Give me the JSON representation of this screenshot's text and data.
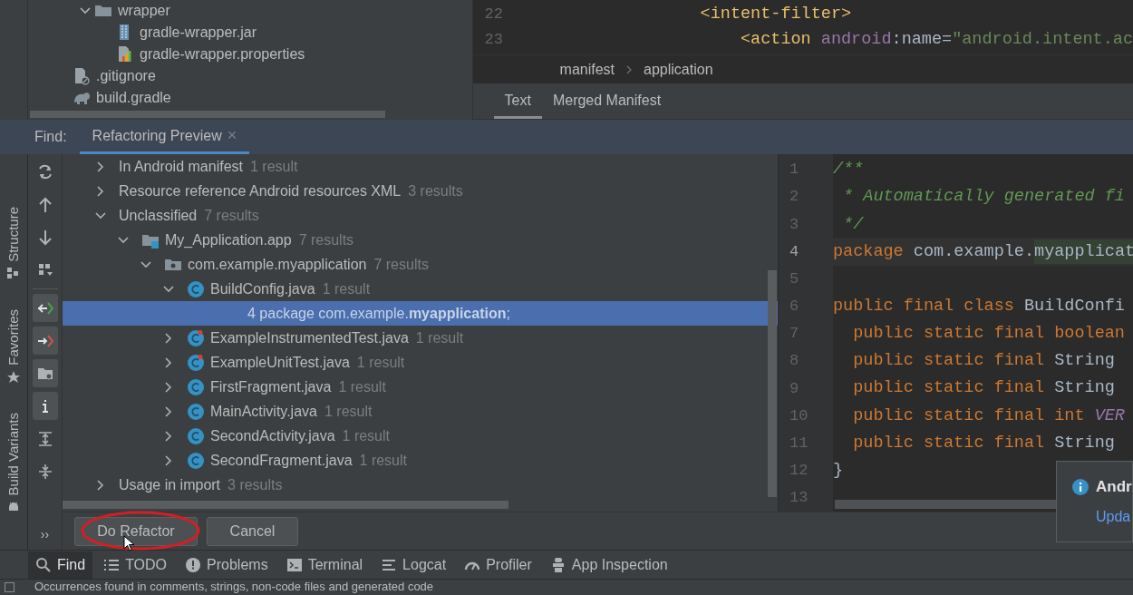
{
  "project_tree": {
    "items": [
      {
        "children": [
          {
            "label": "wrapper",
            "kind": "folder",
            "expanded": true,
            "children": [
              {
                "label": "gradle-wrapper.jar",
                "kind": "jar"
              },
              {
                "label": "gradle-wrapper.properties",
                "kind": "properties"
              }
            ]
          }
        ]
      },
      {
        "label": ".gitignore",
        "kind": "ignore"
      },
      {
        "label": "build.gradle",
        "kind": "gradle"
      }
    ]
  },
  "manifest_editor": {
    "lines": [
      {
        "number": "22",
        "tokens": [
          {
            "kind": "tag",
            "text": "          <intent-filter>"
          }
        ]
      },
      {
        "number": "23",
        "tokens": [
          {
            "kind": "tag",
            "text": "              <action "
          },
          {
            "kind": "attr",
            "text": "android"
          },
          {
            "kind": "plain",
            "text": ":name="
          },
          {
            "kind": "string",
            "text": "\"android.intent.ac"
          }
        ]
      }
    ],
    "breadcrumb": [
      "manifest",
      "application"
    ],
    "tabs": [
      {
        "label": "Text",
        "selected": true
      },
      {
        "label": "Merged Manifest",
        "selected": false
      }
    ]
  },
  "find_panel": {
    "label": "Find:",
    "tab": {
      "label": "Refactoring Preview",
      "close": "×"
    },
    "toolbar": [
      {
        "on": false
      },
      {
        "on": false
      },
      {
        "on": false
      },
      {
        "on": false
      },
      {
        "on": true
      },
      {
        "on": true
      },
      {
        "on": true
      },
      {
        "on": true
      },
      {
        "on": false
      },
      {
        "on": false
      }
    ],
    "more": "››",
    "side_tabs": [
      "Structure",
      "Favorites",
      "Build Variants"
    ],
    "tree": [
      {
        "label": "In Android manifest",
        "count": "1 result",
        "expanded": false,
        "selected": false
      },
      {
        "label": "Resource reference Android resources XML",
        "count": "3 results",
        "expanded": false,
        "selected": false
      },
      {
        "label": "Unclassified",
        "count": "7 results",
        "expanded": true,
        "selected": false,
        "children": [
          {
            "label": "My_Application.app",
            "count": "7 results",
            "kind": "module",
            "expanded": true,
            "selected": false,
            "children": [
              {
                "label": "com.example.myapplication",
                "count": "7 results",
                "kind": "package",
                "expanded": true,
                "selected": false,
                "children": [
                  {
                    "label": "BuildConfig.java",
                    "count": "1 result",
                    "kind": "class",
                    "expanded": true,
                    "selected": false,
                    "children": [
                      {
                        "label": "4 package com.example.**myapplication**;",
                        "kind": "match",
                        "selected": true
                      }
                    ]
                  },
                  {
                    "label": "ExampleInstrumentedTest.java",
                    "count": "1 result",
                    "kind": "test",
                    "expanded": false,
                    "selected": false
                  },
                  {
                    "label": "ExampleUnitTest.java",
                    "count": "1 result",
                    "kind": "test",
                    "expanded": false,
                    "selected": false
                  },
                  {
                    "label": "FirstFragment.java",
                    "count": "1 result",
                    "kind": "class",
                    "expanded": false,
                    "selected": false
                  },
                  {
                    "label": "MainActivity.java",
                    "count": "1 result",
                    "kind": "class",
                    "expanded": false,
                    "selected": false
                  },
                  {
                    "label": "SecondActivity.java",
                    "count": "1 result",
                    "kind": "class",
                    "expanded": false,
                    "selected": false
                  },
                  {
                    "label": "SecondFragment.java",
                    "count": "1 result",
                    "kind": "class",
                    "expanded": false,
                    "selected": false
                  }
                ]
              }
            ]
          }
        ]
      },
      {
        "label": "Usage in import",
        "count": "3 results",
        "expanded": false,
        "selected": false
      }
    ],
    "buttons": [
      {
        "label": "Do Refactor"
      },
      {
        "label": "Cancel"
      }
    ]
  },
  "preview_editor": {
    "lines": [
      {
        "number": "1",
        "tokens": [
          {
            "kind": "comment",
            "text": "/**"
          }
        ]
      },
      {
        "number": "2",
        "tokens": [
          {
            "kind": "comment",
            "text": " * Automatically generated fi"
          }
        ]
      },
      {
        "number": "3",
        "tokens": [
          {
            "kind": "comment",
            "text": " */"
          }
        ]
      },
      {
        "number": "4",
        "current": true,
        "tokens": [
          {
            "kind": "keyword",
            "text": "package "
          },
          {
            "kind": "plain",
            "text": "com.example."
          },
          {
            "kind": "highlight",
            "text": "myapplicat"
          }
        ]
      },
      {
        "number": "5"
      },
      {
        "number": "6",
        "tokens": [
          {
            "kind": "keyword",
            "text": "public final class "
          },
          {
            "kind": "plain",
            "text": "BuildConfi"
          }
        ]
      },
      {
        "number": "7",
        "tokens": [
          {
            "kind": "keyword",
            "text": "  public static final boolean"
          }
        ]
      },
      {
        "number": "8",
        "tokens": [
          {
            "kind": "keyword",
            "text": "  public static final "
          },
          {
            "kind": "plain",
            "text": "String"
          }
        ]
      },
      {
        "number": "9",
        "tokens": [
          {
            "kind": "keyword",
            "text": "  public static final "
          },
          {
            "kind": "plain",
            "text": "String"
          }
        ]
      },
      {
        "number": "10",
        "tokens": [
          {
            "kind": "keyword",
            "text": "  public static final int "
          },
          {
            "kind": "constant",
            "text": "VER"
          }
        ]
      },
      {
        "number": "11",
        "tokens": [
          {
            "kind": "keyword",
            "text": "  public static final "
          },
          {
            "kind": "plain",
            "text": "String"
          }
        ]
      },
      {
        "number": "12",
        "tokens": [
          {
            "kind": "plain",
            "text": "}"
          }
        ]
      },
      {
        "number": "13"
      }
    ]
  },
  "notification": {
    "title": "Andr",
    "link": "Upda"
  },
  "tool_windows": [
    {
      "label": "Find",
      "selected": true
    },
    {
      "label": "TODO",
      "selected": false
    },
    {
      "label": "Problems",
      "selected": false
    },
    {
      "label": "Terminal",
      "selected": false
    },
    {
      "label": "Logcat",
      "selected": false
    },
    {
      "label": "Profiler",
      "selected": false
    },
    {
      "label": "App Inspection",
      "selected": false
    }
  ],
  "status_bar": "Occurrences found in comments, strings, non-code files and generated code"
}
